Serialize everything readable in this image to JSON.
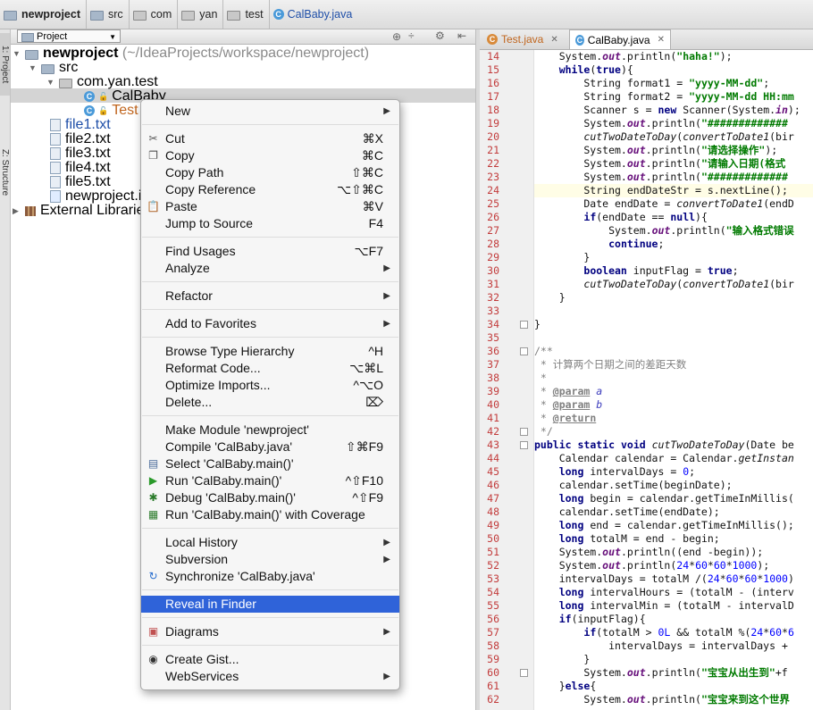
{
  "breadcrumb": [
    "newproject",
    "src",
    "com",
    "yan",
    "test",
    "CalBaby.java"
  ],
  "project_panel": {
    "vertical_tabs": [
      "1: Project",
      "Z: Structure"
    ],
    "selector": "Project",
    "tree": {
      "root": "newproject",
      "root_path": "(~/IdeaProjects/workspace/newproject)",
      "src": "src",
      "package": "com.yan.test",
      "class1": "CalBaby",
      "class2": "Test",
      "files": [
        "file1.txt",
        "file2.txt",
        "file3.txt",
        "file4.txt",
        "file5.txt"
      ],
      "iml": "newproject.iml",
      "libs": "External Libraries"
    }
  },
  "editor": {
    "tabs": [
      "Test.java",
      "CalBaby.java"
    ],
    "active_tab": "CalBaby.java"
  },
  "code_lines": [
    {
      "n": "14",
      "t": "    System.out.println(\"haha!\");"
    },
    {
      "n": "15",
      "t": "    while(true){"
    },
    {
      "n": "16",
      "t": "        String format1 = \"yyyy-MM-dd\";"
    },
    {
      "n": "17",
      "t": "        String format2 = \"yyyy-MM-dd HH:mm"
    },
    {
      "n": "18",
      "t": "        Scanner s = new Scanner(System.in);"
    },
    {
      "n": "19",
      "t": "        System.out.println(\"#############"
    },
    {
      "n": "20",
      "t": "        cutTwoDateToDay(convertToDate1(bir"
    },
    {
      "n": "21",
      "t": "        System.out.println(\"请选择操作\");"
    },
    {
      "n": "22",
      "t": "        System.out.println(\"请输入日期(格式"
    },
    {
      "n": "23",
      "t": "        System.out.println(\"#############"
    },
    {
      "n": "24",
      "t": "        String endDateStr = s.nextLine();"
    },
    {
      "n": "25",
      "t": "        Date endDate = convertToDate1(endD"
    },
    {
      "n": "26",
      "t": "        if(endDate == null){"
    },
    {
      "n": "27",
      "t": "            System.out.println(\"输入格式错误"
    },
    {
      "n": "28",
      "t": "            continue;"
    },
    {
      "n": "29",
      "t": "        }"
    },
    {
      "n": "30",
      "t": "        boolean inputFlag = true;"
    },
    {
      "n": "31",
      "t": "        cutTwoDateToDay(convertToDate1(bir"
    },
    {
      "n": "32",
      "t": "    }"
    },
    {
      "n": "33",
      "t": ""
    },
    {
      "n": "34",
      "t": "}"
    },
    {
      "n": "35",
      "t": ""
    },
    {
      "n": "36",
      "t": "/**"
    },
    {
      "n": "37",
      "t": " * 计算两个日期之间的差距天数"
    },
    {
      "n": "38",
      "t": " *"
    },
    {
      "n": "39",
      "t": " * @param a"
    },
    {
      "n": "40",
      "t": " * @param b"
    },
    {
      "n": "41",
      "t": " * @return"
    },
    {
      "n": "42",
      "t": " */"
    },
    {
      "n": "43",
      "t": "public static void cutTwoDateToDay(Date be"
    },
    {
      "n": "44",
      "t": "    Calendar calendar = Calendar.getInstan"
    },
    {
      "n": "45",
      "t": "    long intervalDays = 0;"
    },
    {
      "n": "46",
      "t": "    calendar.setTime(beginDate);"
    },
    {
      "n": "47",
      "t": "    long begin = calendar.getTimeInMillis("
    },
    {
      "n": "48",
      "t": "    calendar.setTime(endDate);"
    },
    {
      "n": "49",
      "t": "    long end = calendar.getTimeInMillis();"
    },
    {
      "n": "50",
      "t": "    long totalM = end - begin;"
    },
    {
      "n": "51",
      "t": "    System.out.println((end -begin));"
    },
    {
      "n": "52",
      "t": "    System.out.println(24*60*60*1000);"
    },
    {
      "n": "53",
      "t": "    intervalDays = totalM /(24*60*60*1000)"
    },
    {
      "n": "54",
      "t": "    long intervalHours = (totalM - (interv"
    },
    {
      "n": "55",
      "t": "    long intervalMin = (totalM - intervalD"
    },
    {
      "n": "56",
      "t": "    if(inputFlag){"
    },
    {
      "n": "57",
      "t": "        if(totalM > 0L && totalM %(24*60*6"
    },
    {
      "n": "58",
      "t": "            intervalDays = intervalDays +"
    },
    {
      "n": "59",
      "t": "        }"
    },
    {
      "n": "60",
      "t": "        System.out.println(\"宝宝从出生到\"+f"
    },
    {
      "n": "61",
      "t": "    }else{"
    },
    {
      "n": "62",
      "t": "        System.out.println(\"宝宝来到这个世界"
    }
  ],
  "menu": {
    "items": [
      {
        "label": "New",
        "sub": true
      },
      {
        "label": "Cut",
        "shortcut": "⌘X",
        "icon": "scissors-icon"
      },
      {
        "label": "Copy",
        "shortcut": "⌘C",
        "icon": "copy-icon"
      },
      {
        "label": "Copy Path",
        "shortcut": "⇧⌘C"
      },
      {
        "label": "Copy Reference",
        "shortcut": "⌥⇧⌘C"
      },
      {
        "label": "Paste",
        "shortcut": "⌘V",
        "icon": "paste-icon"
      },
      {
        "label": "Jump to Source",
        "shortcut": "F4"
      },
      {
        "label": "Find Usages",
        "shortcut": "⌥F7"
      },
      {
        "label": "Analyze",
        "sub": true
      },
      {
        "label": "Refactor",
        "sub": true
      },
      {
        "label": "Add to Favorites",
        "sub": true
      },
      {
        "label": "Browse Type Hierarchy",
        "shortcut": "^H"
      },
      {
        "label": "Reformat Code...",
        "shortcut": "⌥⌘L"
      },
      {
        "label": "Optimize Imports...",
        "shortcut": "^⌥O"
      },
      {
        "label": "Delete...",
        "shortcut": "⌦"
      },
      {
        "label": "Make Module 'newproject'"
      },
      {
        "label": "Compile 'CalBaby.java'",
        "shortcut": "⇧⌘F9"
      },
      {
        "label": "Select 'CalBaby.main()'",
        "icon": "select-icon"
      },
      {
        "label": "Run 'CalBaby.main()'",
        "shortcut": "^⇧F10",
        "icon": "run-icon"
      },
      {
        "label": "Debug 'CalBaby.main()'",
        "shortcut": "^⇧F9",
        "icon": "debug-icon"
      },
      {
        "label": "Run 'CalBaby.main()' with Coverage",
        "icon": "coverage-icon"
      },
      {
        "label": "Local History",
        "sub": true
      },
      {
        "label": "Subversion",
        "sub": true
      },
      {
        "label": "Synchronize 'CalBaby.java'",
        "icon": "sync-icon"
      },
      {
        "label": "Reveal in Finder",
        "selected": true
      },
      {
        "label": "Diagrams",
        "sub": true,
        "icon": "diagram-icon"
      },
      {
        "label": "Create Gist...",
        "icon": "github-icon"
      },
      {
        "label": "WebServices",
        "sub": true
      }
    ]
  },
  "colors": {
    "selection": "#2f63d9",
    "line_number": "#c23b3b",
    "keyword": "#000080",
    "string": "#007a00"
  }
}
